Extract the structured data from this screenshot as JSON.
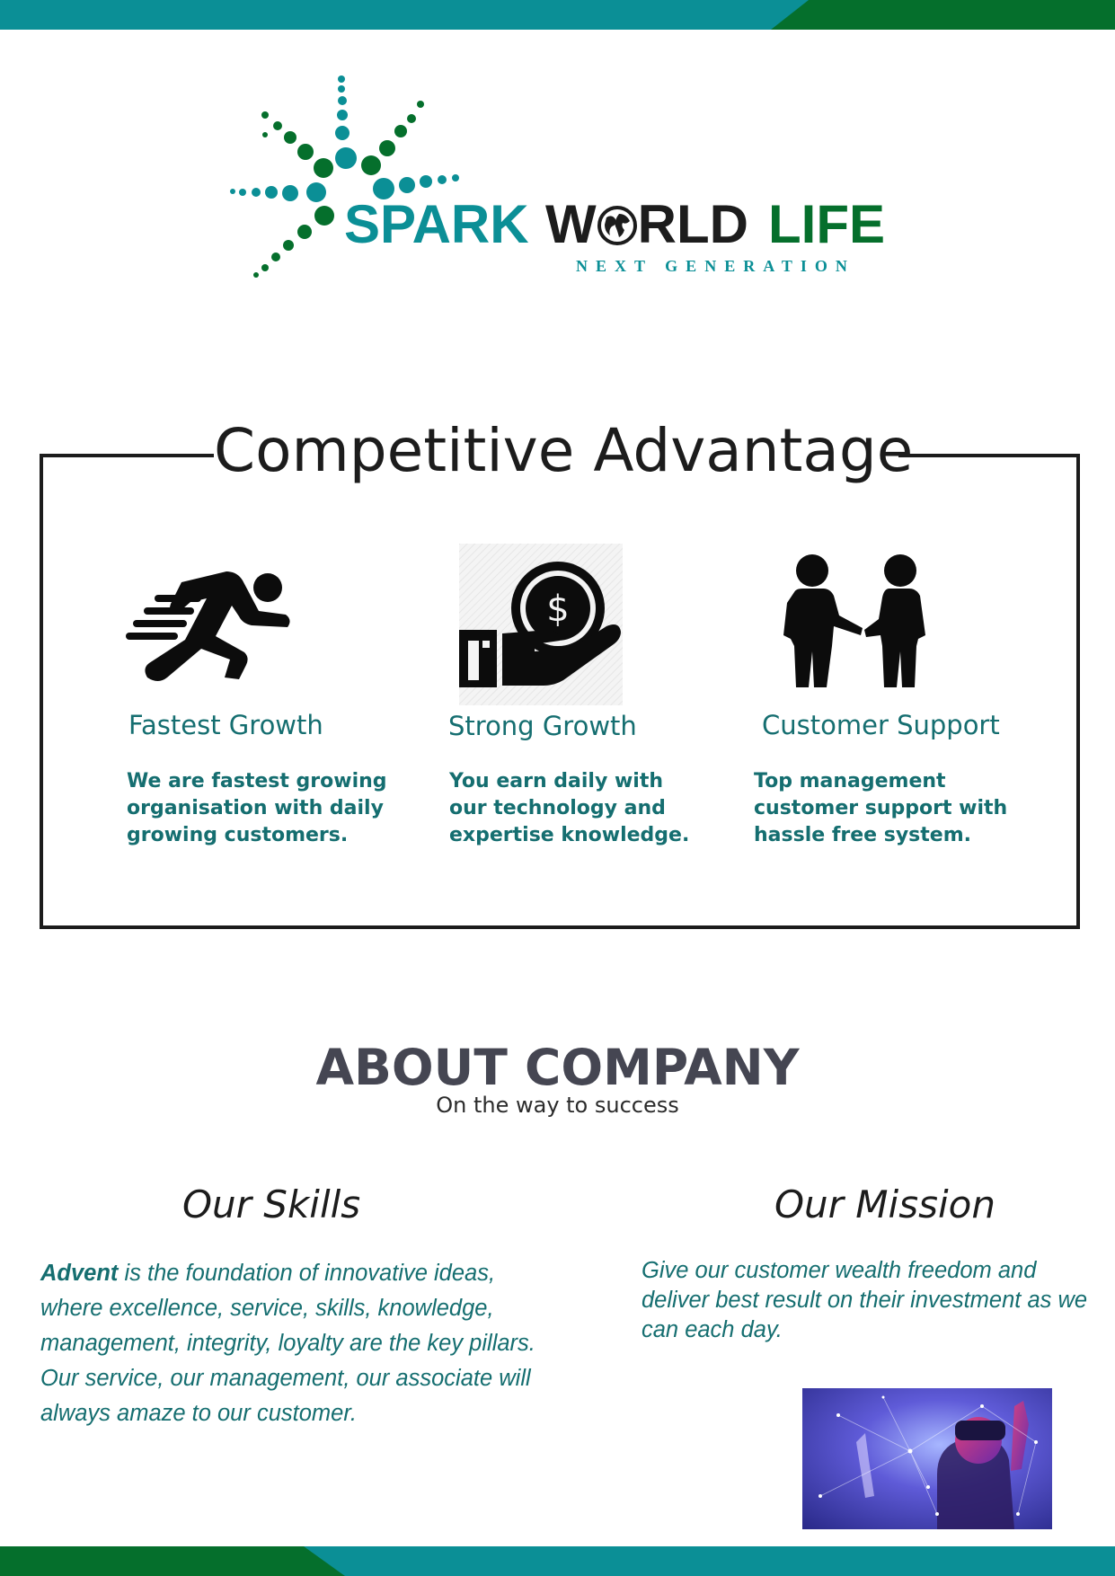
{
  "colors": {
    "teal": "#0b8f96",
    "green": "#056f2c",
    "dark": "#1c1c1c",
    "text_teal": "#156e70",
    "about_gray": "#454652"
  },
  "brand": {
    "word1": "SPARK",
    "word2_start": "W",
    "word2_end": "RLD",
    "word3": "LIFE",
    "tagline": "NEXT GENERATION"
  },
  "advantage": {
    "title": "Competitive Advantage",
    "items": [
      {
        "icon": "running-man-icon",
        "title": "Fastest Growth",
        "desc": "We are fastest growing organisation with daily growing customers."
      },
      {
        "icon": "hand-coin-icon",
        "title": "Strong Growth",
        "desc": "You earn daily with our technology and expertise knowledge."
      },
      {
        "icon": "handshake-people-icon",
        "title": "Customer Support",
        "desc": "Top management customer support with hassle free system."
      }
    ]
  },
  "about": {
    "title": "ABOUT COMPANY",
    "subtitle": "On the way to success"
  },
  "skills": {
    "heading": "Our Skills",
    "lead": "Advent",
    "text": " is the foundation of innovative ideas, where excellence, service, skills, knowledge, management, integrity, loyalty are the key pillars. Our service, our management, our associate will always amaze to our customer."
  },
  "mission": {
    "heading": "Our Mission",
    "text": "Give our customer wealth freedom and deliver best result on their investment as we can each day."
  }
}
